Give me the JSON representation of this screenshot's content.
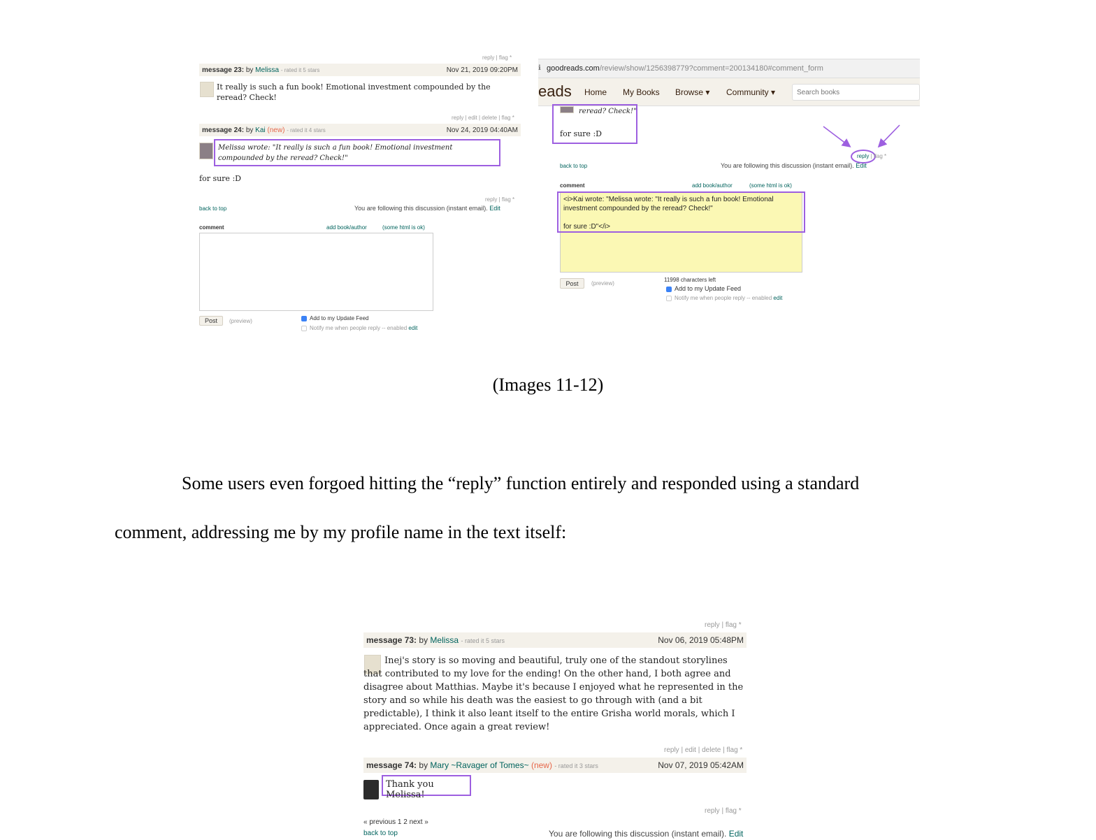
{
  "left": {
    "msg23": {
      "actions": "reply | flag *",
      "label": "message 23:",
      "by": "by",
      "author": "Melissa",
      "rated": "- rated it 5 stars",
      "date": "Nov 21, 2019 09:20PM",
      "body": "It really is such a fun book! Emotional investment compounded by the reread? Check!"
    },
    "msg24": {
      "actions": "reply | edit | delete | flag *",
      "label": "message 24:",
      "by": "by",
      "author": "Kai",
      "new": "(new)",
      "rated": "- rated it 4 stars",
      "date": "Nov 24, 2019 04:40AM",
      "quote": "Melissa wrote: \"It really is such a fun book! Emotional investment compounded by the reread? Check!\"",
      "body": "for sure :D"
    },
    "footer_actions": "reply | flag *",
    "back_to_top": "back to top",
    "following": "You are following this discussion (instant email).",
    "edit": "Edit",
    "comment_label": "comment",
    "add_book": "add book/author",
    "some_html": "(some html is ok)",
    "post": "Post",
    "preview": "(preview)",
    "update_feed": "Add to my Update Feed",
    "notify": "Notify me when people reply -- enabled",
    "notify_edit": "edit"
  },
  "right": {
    "url_domain": "goodreads.com",
    "url_path": "/review/show/1256398779?comment=200134180#comment_form",
    "logo": "eads",
    "nav": [
      "Home",
      "My Books",
      "Browse ▾",
      "Community ▾"
    ],
    "search_placeholder": "Search books",
    "quote_tail": "reread? Check!\"",
    "body": "for sure :D",
    "reply": "reply",
    "flag": "| flag *",
    "back_to_top": "back to top",
    "following": "You are following this discussion (instant email).",
    "edit": "Edit",
    "comment_label": "comment",
    "add_book": "add book/author",
    "some_html": "(some html is ok)",
    "textarea_text": "<i>Kai wrote: \"Melissa wrote: \"It really is such a fun book! Emotional investment compounded by the reread? Check!\"\n\nfor sure :D\"</i>",
    "chars_left": "11998 characters left",
    "post": "Post",
    "preview": "(preview)",
    "update_feed": "Add to my Update Feed",
    "notify": "Notify me when people reply -- enabled",
    "notify_edit": "edit"
  },
  "caption": "(Images 11-12)",
  "paragraph_line1": "Some users even forgoed hitting the “reply” function entirely and responded using a standard",
  "paragraph_line2": "comment, addressing me by my profile name in the text itself:",
  "bottom": {
    "msg73": {
      "actions": "reply | flag *",
      "label": "message 73:",
      "by": "by",
      "author": "Melissa",
      "rated": "- rated it 5 stars",
      "date": "Nov 06, 2019 05:48PM",
      "body": "Inej's story is so moving and beautiful, truly one of the standout storylines that contributed to my love for the ending! On the other hand, I both agree and disagree about Matthias. Maybe it's because I enjoyed what he represented in the story and so while his death was the easiest to go through with (and a bit predictable), I think it also leant itself to the entire Grisha world morals, which I appreciated. Once again a great review!"
    },
    "msg74": {
      "actions": "reply | edit | delete | flag *",
      "label": "message 74:",
      "by": "by",
      "author": "Mary ~Ravager of Tomes~",
      "new": "(new)",
      "rated": "- rated it 3 stars",
      "date": "Nov 07, 2019 05:42AM",
      "body": "Thank you Melissa!"
    },
    "footer_actions": "reply | flag *",
    "pagination": "« previous 1 2 next »",
    "back_to_top": "back to top",
    "following": "You are following this discussion (instant email).",
    "edit": "Edit"
  },
  "colors": {
    "highlight": "#9d5fe0",
    "link": "#00635d",
    "header_bg": "#f4f1ea",
    "new": "#e6674a",
    "textarea_yellow": "#fbf8b4"
  }
}
